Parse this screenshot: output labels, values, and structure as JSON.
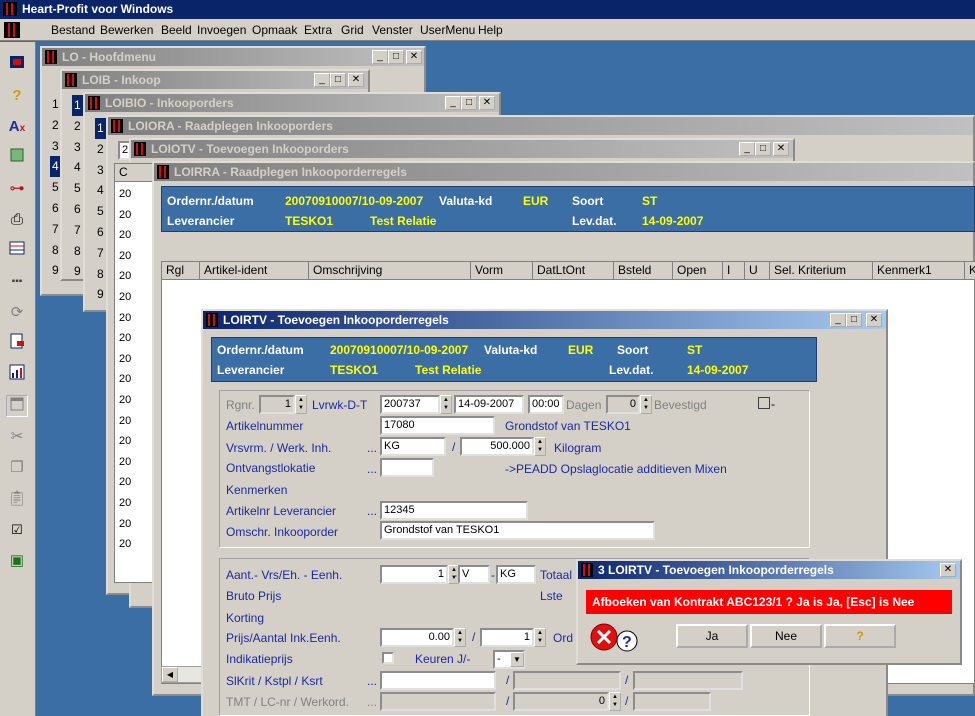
{
  "app": {
    "title": "Heart-Profit voor Windows"
  },
  "menu": [
    "Bestand",
    "Bewerken",
    "Beeld",
    "Invoegen",
    "Opmaak",
    "Extra",
    "Grid",
    "Venster",
    "UserMenu",
    "Help"
  ],
  "toolbar_icons": [
    "app-icon",
    "help-icon",
    "spelling-icon",
    "import-icon",
    "key-icon",
    "print-icon",
    "table-icon",
    "dots-icon",
    "refresh-icon",
    "export-icon",
    "report-icon",
    "window-icon",
    "cut-icon",
    "copy-icon",
    "paste-icon",
    "query-icon",
    "monitor-icon"
  ],
  "windows": {
    "lo": {
      "title": "LO - Hoofdmenu",
      "nums": [
        "1",
        "2",
        "3",
        "4",
        "5",
        "6",
        "7",
        "8",
        "9"
      ]
    },
    "loib": {
      "title": "LOIB - Inkoop",
      "nums": [
        "1",
        "2",
        "3",
        "4",
        "5",
        "6",
        "7",
        "8",
        "9"
      ]
    },
    "loibio": {
      "title": "LOIBIO - Inkooporders",
      "nums": [
        "1",
        "2",
        "3",
        "4",
        "5",
        "6",
        "7",
        "8",
        "9"
      ]
    },
    "loiora": {
      "title": "LOIORA - Raadplegen Inkooporders",
      "nums": [
        "2",
        "2",
        "2",
        "2",
        "2",
        "2",
        "2",
        "2",
        "2",
        "2",
        "2",
        "2",
        "2",
        "2",
        "2",
        "2",
        "2",
        "2",
        "2",
        "2",
        "2",
        "2",
        "2"
      ],
      "first": "2"
    },
    "loiotv": {
      "title": "LOIOTV - Toevoegen Inkooporders",
      "header": "C",
      "rows": [
        "20",
        "20",
        "20",
        "20",
        "20",
        "20",
        "20",
        "20",
        "20",
        "20",
        "20",
        "20",
        "20",
        "20",
        "20",
        "20",
        "20",
        "20",
        "20",
        "20",
        "20",
        "20"
      ]
    },
    "loirra": {
      "title": "LOIRRA - Raadplegen Inkooporderregels"
    }
  },
  "order_header": {
    "ordernr_label": "Ordernr./datum",
    "ordernr_value": "20070910007/10-09-2007",
    "valuta_label": "Valuta-kd",
    "valuta_value": "EUR",
    "soort_label": "Soort",
    "soort_value": "ST",
    "leverancier_label": "Leverancier",
    "leverancier_value": "TESKO1",
    "relatie_value": "Test Relatie",
    "levdat_label": "Lev.dat.",
    "levdat_value": "14-09-2007"
  },
  "grid_columns": [
    "Rgl",
    "Artikel-ident",
    "Omschrijving",
    "Vorm",
    "DatLtOnt",
    "Bsteld",
    "Open",
    "I",
    "U",
    "Sel. Kriterium",
    "Kenmerk1",
    "K"
  ],
  "form": {
    "title": "LOIRTV - Toevoegen Inkooporderregels",
    "rgnr_label": "Rgnr.",
    "rgnr_value": "1",
    "lvrwk_label": "Lvrwk-D-T",
    "lvrwk_week": "200737",
    "lvrwk_date": "14-09-2007",
    "lvrwk_time": "00:00",
    "dagen_label": "Dagen",
    "dagen_value": "0",
    "bevestigd_label": "Bevestigd",
    "bevestigd_box": "-",
    "artikelnummer_label": "Artikelnummer",
    "artikelnummer_value": "17080",
    "artikel_desc": "Grondstof van TESKO1",
    "vrsvrm_label": "Vrsvrm. / Werk. Inh.",
    "vrsvrm_value": "KG",
    "slash": "/",
    "inh_value": "500.000",
    "inh_unit": "Kilogram",
    "ontv_label": "Ontvangstlokatie",
    "ontv_desc": "->PEADD Opslaglocatie additieven Mixen",
    "kenmerken_label": "Kenmerken",
    "artlev_label": "Artikelnr Leverancier",
    "artlev_value": "12345",
    "omschr_label": "Omschr. Inkooporder",
    "omschr_value": "Grondstof van TESKO1",
    "aant_label": "Aant.- Vrs/Eh. - Eenh.",
    "aant_value": "1",
    "aant_v": "V",
    "aant_unit": "KG",
    "totaal_label": "Totaal",
    "bruto_label": "Bruto Prijs",
    "lste_label": "Lste",
    "korting_label": "Korting",
    "prijs_label": "Prijs/Aantal Ink.Eenh.",
    "prijs_value": "0.00",
    "prijs_aantal": "1",
    "ord_label": "Ord",
    "indicatie_label": "Indikatieprijs",
    "keuren_label": "Keuren J/-",
    "keuren_value": "-",
    "slkrit_label": "SlKrit / Kstpl / Ksrt",
    "tmt_label": "TMT / LC-nr / Werkord.",
    "tmt_value": "0",
    "dots": "..."
  },
  "dialog": {
    "title": "3 LOIRTV - Toevoegen Inkooporderregels",
    "message": "Afboeken van Kontrakt ABC123/1 ?  Ja is Ja, [Esc] is Nee",
    "ja": "Ja",
    "nee": "Nee",
    "help": "?"
  },
  "colors": {
    "title_active": "#0a246a",
    "desktop": "#3a6ea5",
    "header_value": "#ffff00",
    "label_blue": "#1b2aa0",
    "dialog_message_bg": "#ff0000"
  }
}
